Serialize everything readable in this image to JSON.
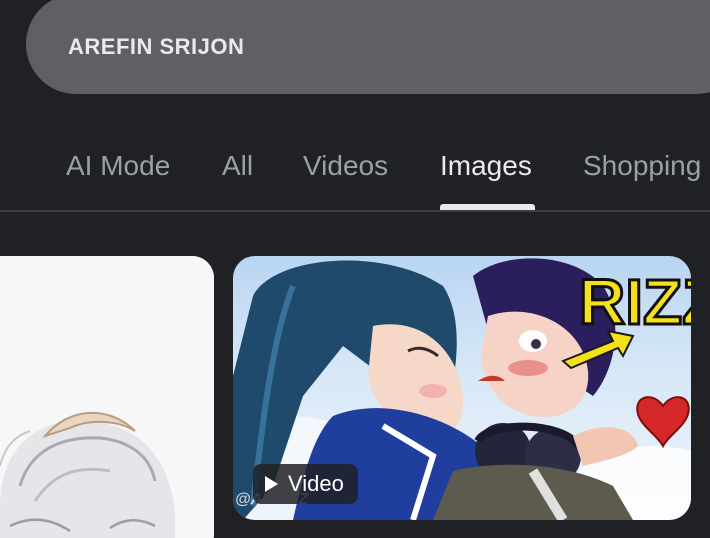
{
  "search": {
    "query": "AREFIN SRIJON"
  },
  "tabs": [
    {
      "label": "AI Mode"
    },
    {
      "label": "All"
    },
    {
      "label": "Videos"
    },
    {
      "label": "Images"
    },
    {
      "label": "Shopping"
    }
  ],
  "active_tab": "Images",
  "results": {
    "right_card": {
      "badge_label": "Video",
      "overlay_text": "RIZZ",
      "watermark": "@ANI KIZ"
    }
  },
  "colors": {
    "background": "#202124",
    "search_box": "#5f6063",
    "tab_inactive": "#9aa0a6",
    "tab_active": "#e8eaed"
  }
}
